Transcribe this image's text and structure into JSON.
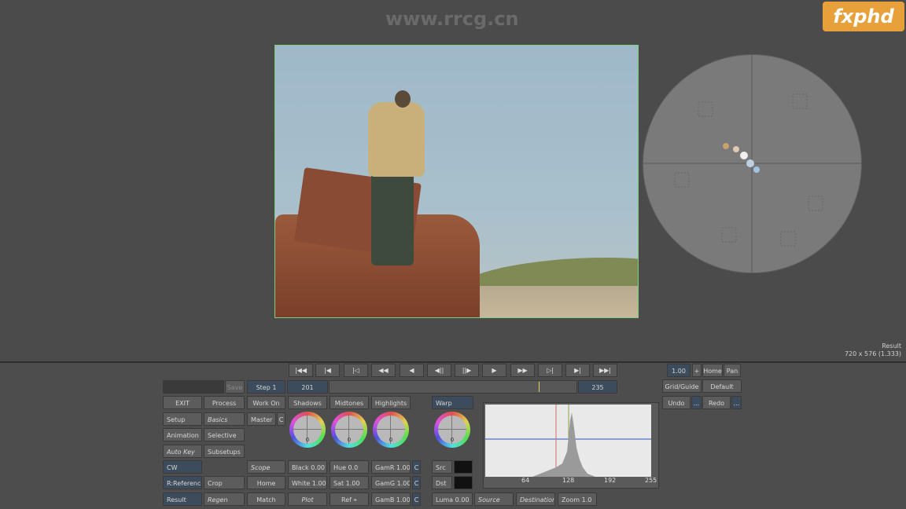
{
  "watermark": "www.rrcg.cn",
  "logo": "fxphd",
  "viewer": {
    "mode": "Result",
    "resolution": "720 x 576 (1.333)"
  },
  "transport": [
    "|◀◀",
    "|◀",
    "|◁",
    "◀◀",
    "◀",
    "◀||",
    "||▶",
    "▶",
    "▶▶",
    "▷|",
    "▶|",
    "▶▶|"
  ],
  "top_right": {
    "zoom_value": "1.00",
    "home": "Home",
    "pan": "Pan",
    "grid_guide": "Grid/Guide",
    "default": "Default",
    "undo": "Undo",
    "undo_more": "...",
    "redo": "Redo",
    "redo_more": "..."
  },
  "row1": {
    "save": "Save",
    "step": "Step 1",
    "frame": "201",
    "end_frame": "235"
  },
  "left": {
    "exit": "EXIT",
    "process": "Process",
    "work_on": "Work On",
    "setup": "Setup",
    "basics": "Basics",
    "master": "Master",
    "master_c": "C",
    "animation": "Animation",
    "selective": "Selective",
    "auto_key": "Auto Key",
    "subsetups": "Subsetups",
    "cw": "CW",
    "scope": "Scope",
    "r_reference": "R:Reference",
    "crop": "Crop",
    "home": "Home",
    "result": "Result",
    "regen": "Regen",
    "match": "Match",
    "plot": "Plot",
    "ref": "Ref"
  },
  "tabs": {
    "shadows": "Shadows",
    "midtones": "Midtones",
    "highlights": "Highlights",
    "warp": "Warp"
  },
  "wheels": {
    "shadows": "0",
    "midtones": "0",
    "highlights": "0",
    "warp": "0"
  },
  "controls": {
    "black": "Black 0.00",
    "white": "White 1.00",
    "hue": "Hue 0.0",
    "sat": "Sat 1.00",
    "gamr": "GamR 1.00",
    "gamg": "GamG 1.00",
    "gamb": "GamB 1.00",
    "c": "C",
    "src": "Src",
    "dst": "Dst",
    "luma": "Luma 0.00",
    "source": "Source",
    "destination": "Destination",
    "zoom": "Zoom 1.0"
  },
  "histogram": {
    "ticks": [
      "64",
      "128",
      "192",
      "255"
    ]
  }
}
